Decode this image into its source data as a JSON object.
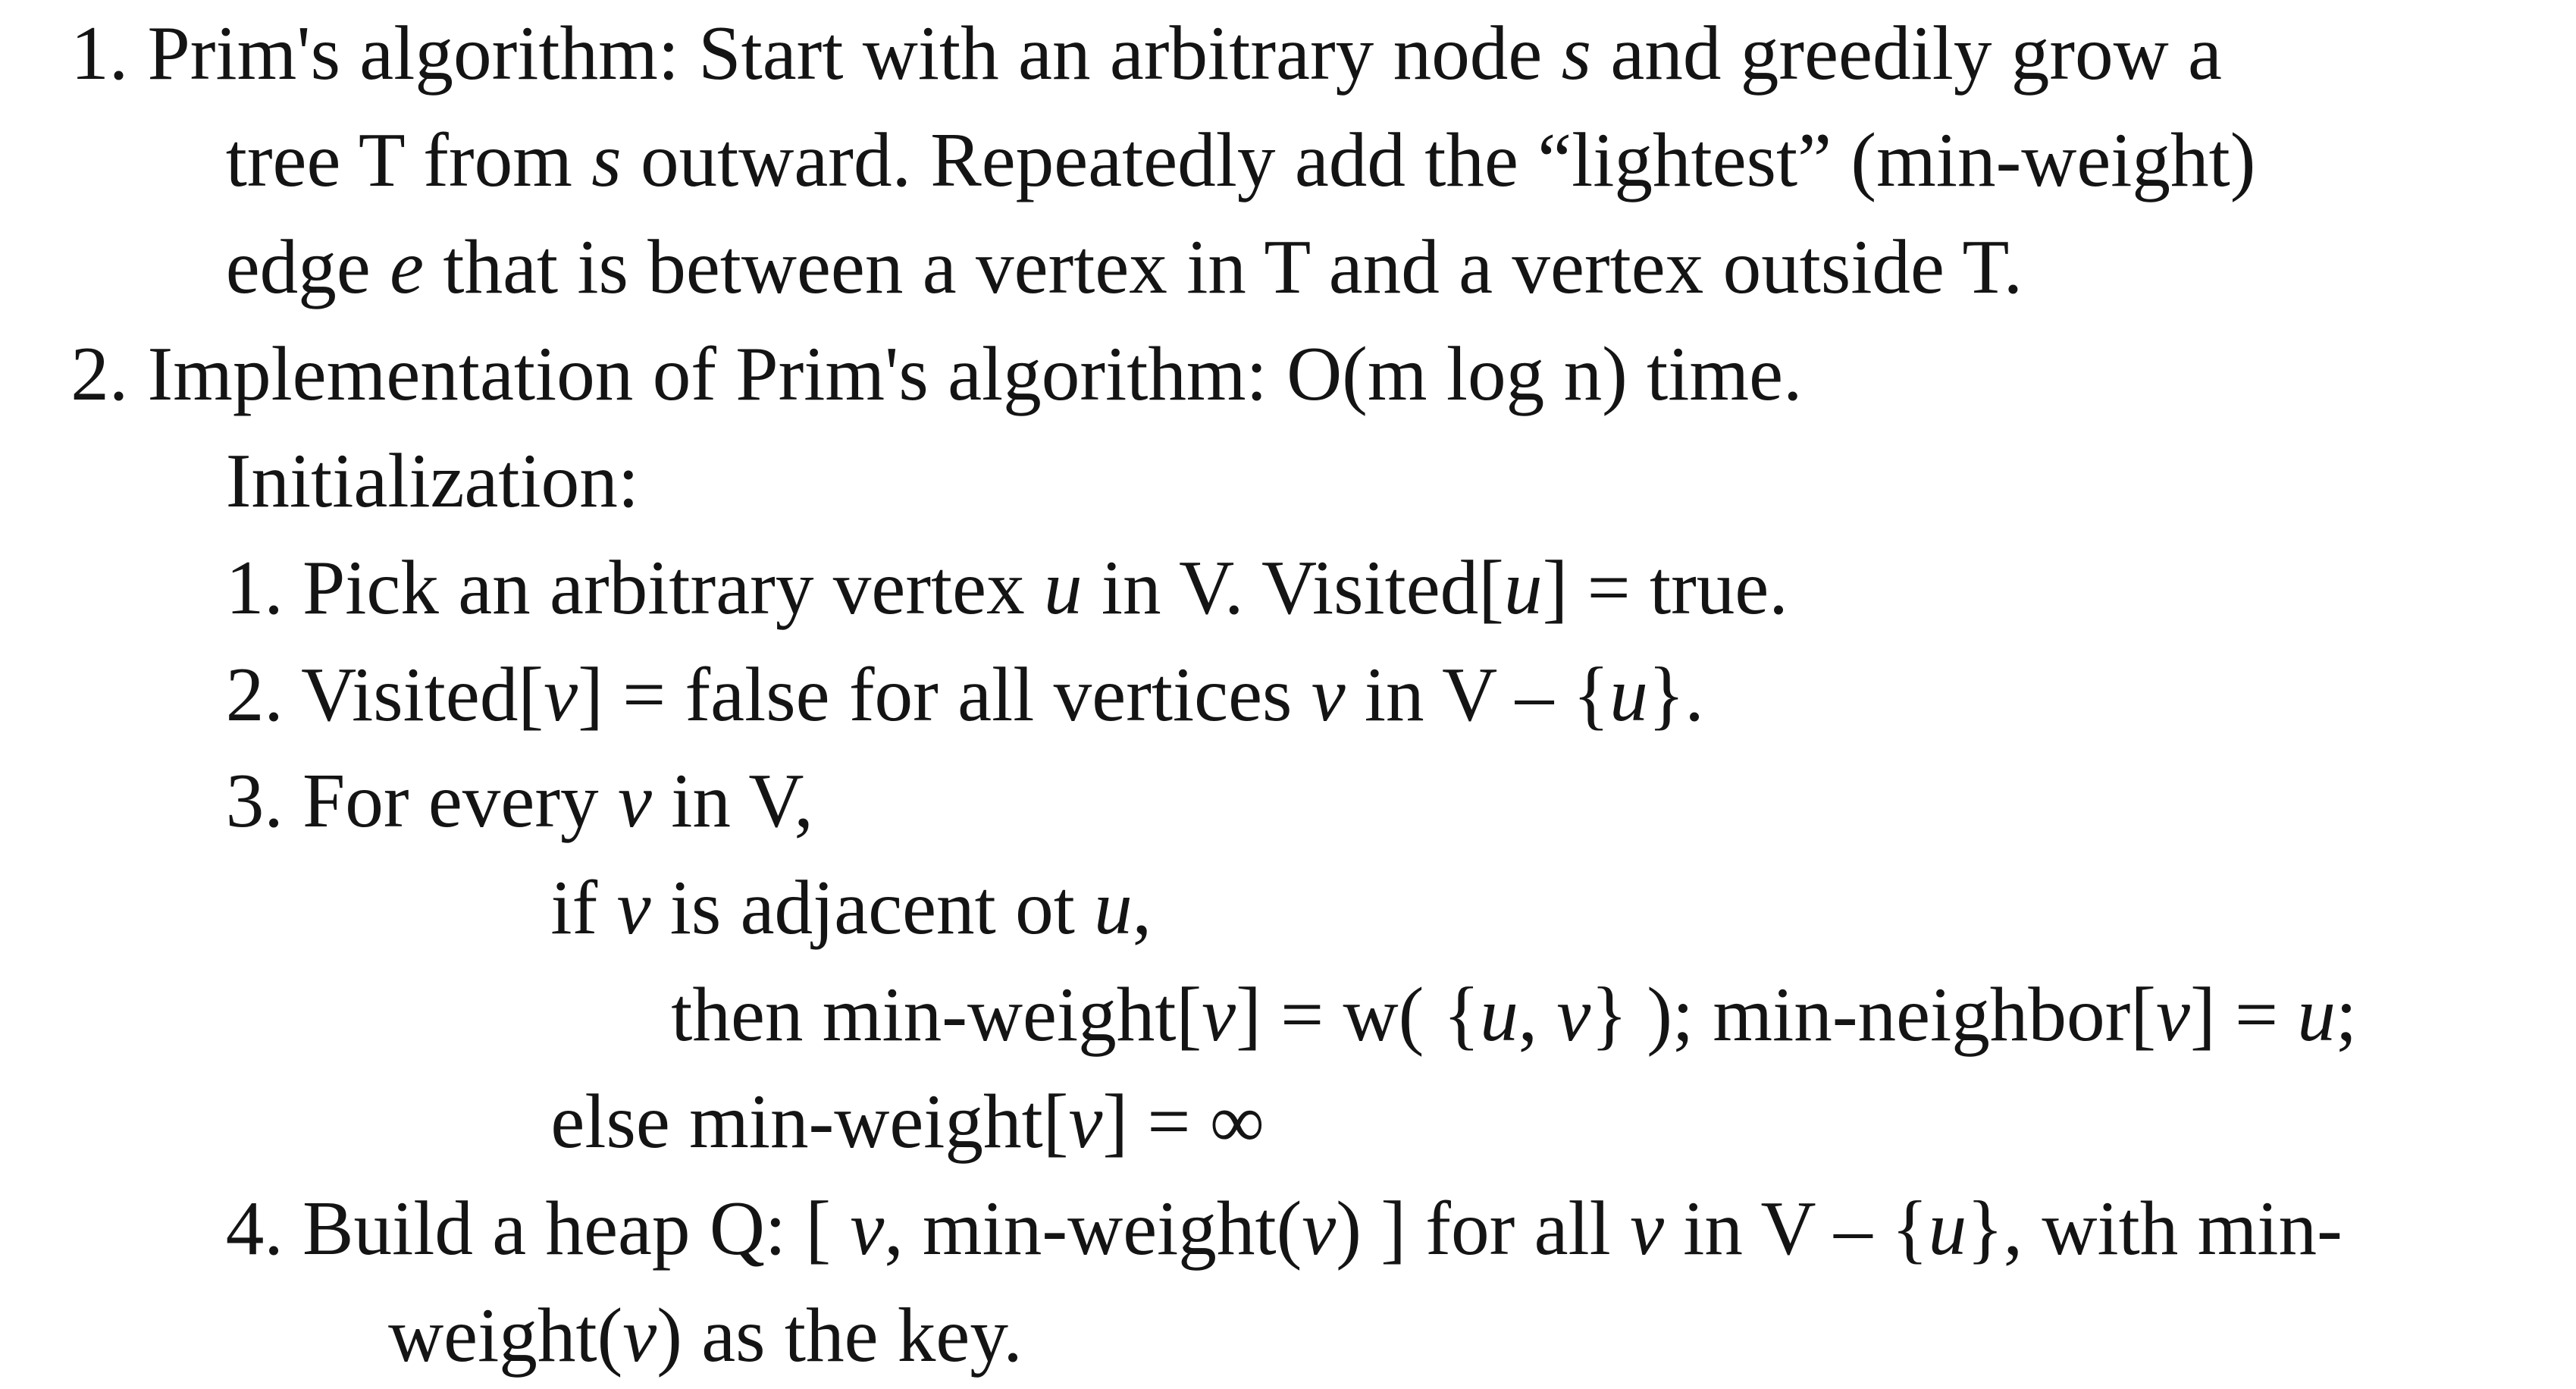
{
  "items": [
    {
      "number": "1.",
      "lines": [
        [
          "Prim's algorithm: Start with an arbitrary node ",
          {
            "i": "s"
          },
          " and greedily grow a"
        ],
        [
          "tree T from ",
          {
            "i": "s"
          },
          " outward. Repeatedly add the “lightest” (min-weight)"
        ],
        [
          "edge ",
          {
            "i": "e"
          },
          " that is between a vertex in T and a vertex outside T."
        ]
      ]
    },
    {
      "number": "2.",
      "lines": [
        [
          "Implementation of Prim's algorithm: O(m log n) time."
        ],
        [
          "Initialization:"
        ]
      ]
    }
  ],
  "init_steps": [
    {
      "number": "1.",
      "lines": [
        [
          "Pick an arbitrary vertex ",
          {
            "i": "u"
          },
          " in V. Visited[",
          {
            "i": "u"
          },
          "] = true."
        ]
      ]
    },
    {
      "number": "2.",
      "lines": [
        [
          "Visited[",
          {
            "i": "v"
          },
          "] = false for all vertices ",
          {
            "i": "v"
          },
          " in V – {",
          {
            "i": "u"
          },
          "}."
        ]
      ]
    },
    {
      "number": "3.",
      "lines": [
        [
          "For every ",
          {
            "i": "v"
          },
          " in V,"
        ],
        [
          "if ",
          {
            "i": "v"
          },
          " is adjacent ot ",
          {
            "i": "u"
          },
          ","
        ],
        [
          "then min-weight[",
          {
            "i": "v"
          },
          "] = w( {",
          {
            "i": "u"
          },
          ", ",
          {
            "i": "v"
          },
          "} ); min-neighbor[",
          {
            "i": "v"
          },
          "] = ",
          {
            "i": "u"
          },
          ";"
        ],
        [
          "else min-weight[",
          {
            "i": "v"
          },
          "] = ∞"
        ]
      ]
    },
    {
      "number": "4.",
      "lines": [
        [
          "Build a heap Q: [ ",
          {
            "i": "v"
          },
          ", min-weight(",
          {
            "i": "v"
          },
          ") ] for all ",
          {
            "i": "v"
          },
          " in V – {",
          {
            "i": "u"
          },
          "}, with min-"
        ],
        [
          "weight(",
          {
            "i": "v"
          },
          ") as the key."
        ]
      ]
    }
  ]
}
